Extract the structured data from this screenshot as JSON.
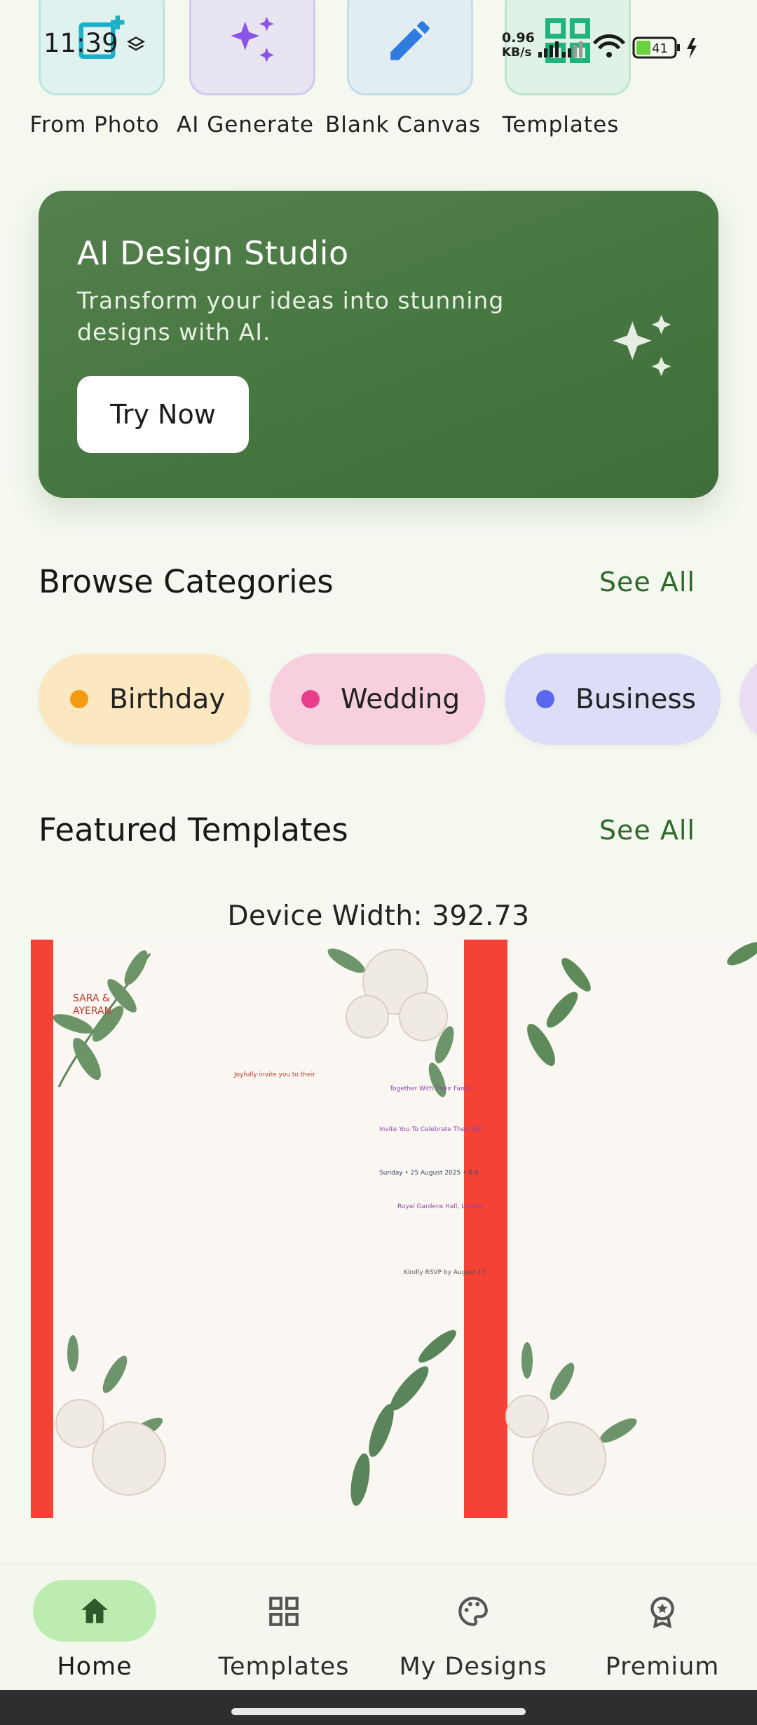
{
  "status_bar": {
    "time": "11:39",
    "net_speed_value": "0.96",
    "net_speed_unit": "KB/s",
    "battery": "41"
  },
  "quick_actions": [
    {
      "label": "From Photo",
      "icon": "add-photo-icon",
      "color": "#1ab0c8"
    },
    {
      "label": "AI Generate",
      "icon": "sparkle-icon",
      "color": "#8a55e6"
    },
    {
      "label": "Blank Canvas",
      "icon": "pencil-icon",
      "color": "#2f7be0"
    },
    {
      "label": "Templates",
      "icon": "grid-icon",
      "color": "#1fb57a"
    }
  ],
  "ai_banner": {
    "title": "AI Design Studio",
    "description": "Transform your ideas into stunning designs with AI.",
    "button": "Try Now"
  },
  "categories_section": {
    "title": "Browse Categories",
    "see_all": "See All",
    "items": [
      {
        "label": "Birthday",
        "dot_color": "#f39c12",
        "bg": "#fbe8c0"
      },
      {
        "label": "Wedding",
        "dot_color": "#e63e8c",
        "bg": "#f8cfdf"
      },
      {
        "label": "Business",
        "dot_color": "#5a67ef",
        "bg": "#dcddf7"
      }
    ]
  },
  "featured_section": {
    "title": "Featured Templates",
    "see_all": "See All",
    "device_width": "Device Width: 392.73",
    "card1": {
      "names": "SARA &\nAYERAN",
      "joy": "Joyfully invite you to their"
    },
    "card2": {
      "line1": "Together With Their Famili",
      "line2": "Invite You To Celebrate Their We",
      "line3": "Sunday  •  25 August 2025  •  6:0",
      "line4": "Royal Gardens Hall, Lahore",
      "line5": "Kindly RSVP by August 15"
    }
  },
  "bottom_nav": [
    {
      "label": "Home",
      "icon": "home-icon",
      "active": true
    },
    {
      "label": "Templates",
      "icon": "templates-grid-icon",
      "active": false
    },
    {
      "label": "My Designs",
      "icon": "palette-icon",
      "active": false
    },
    {
      "label": "Premium",
      "icon": "premium-badge-icon",
      "active": false
    }
  ]
}
